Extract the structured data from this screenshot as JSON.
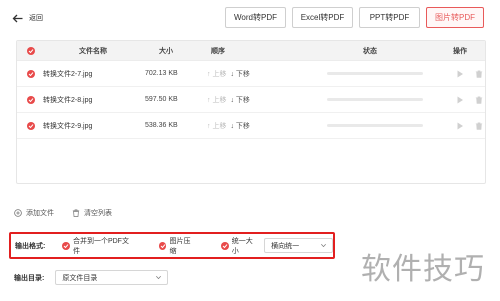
{
  "header": {
    "back_label": "返回",
    "tabs": [
      {
        "label": "Word转PDF"
      },
      {
        "label": "Excel转PDF"
      },
      {
        "label": "PPT转PDF"
      },
      {
        "label": "图片转PDF",
        "active": true
      }
    ]
  },
  "table": {
    "columns": {
      "name": "文件名称",
      "size": "大小",
      "order": "顺序",
      "status": "状态",
      "ops": "操作"
    },
    "rows": [
      {
        "name": "转换文件2-7.jpg",
        "size": "702.13 KB",
        "up": "上移",
        "down": "下移"
      },
      {
        "name": "转换文件2-8.jpg",
        "size": "597.50 KB",
        "up": "上移",
        "down": "下移"
      },
      {
        "name": "转换文件2-9.jpg",
        "size": "538.36 KB",
        "up": "上移",
        "down": "下移"
      }
    ]
  },
  "file_actions": {
    "add": "添加文件",
    "clear": "清空列表"
  },
  "output_format": {
    "label": "输出格式:",
    "option_merge": "合并到一个PDF文件",
    "option_compress": "图片压缩",
    "option_uniform": "统一大小",
    "size_select_value": "横向统一"
  },
  "output_dir": {
    "label": "输出目录:",
    "value": "原文件目录"
  },
  "watermark": "软件技巧",
  "colors": {
    "accent": "#e84a4a",
    "highlight_border": "#e21f1f"
  }
}
